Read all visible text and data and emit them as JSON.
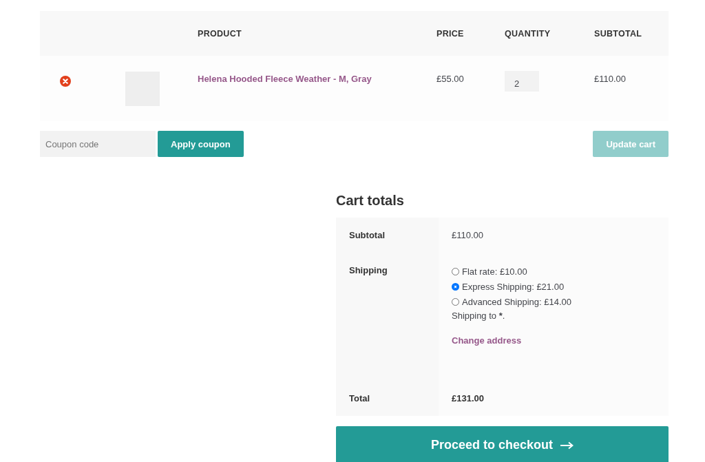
{
  "cart_table": {
    "columns": [
      "PRODUCT",
      "PRICE",
      "QUANTITY",
      "SUBTOTAL"
    ],
    "rows": [
      {
        "product": "Helena Hooded Fleece Weather - M, Gray",
        "price": "£55.00",
        "quantity": "2",
        "subtotal": "£110.00"
      }
    ]
  },
  "coupon": {
    "placeholder": "Coupon code",
    "apply_button": "Apply coupon"
  },
  "update_cart": {
    "label": "Update cart",
    "disabled": true
  },
  "cart_totals": {
    "title": "Cart totals",
    "subtotal_label": "Subtotal",
    "subtotal": "£110.00",
    "shipping_label": "Shipping",
    "shipping_options": [
      {
        "label": "Flat rate: £10.00",
        "selected": false
      },
      {
        "label": "Express Shipping: £21.00",
        "selected": true
      },
      {
        "label": "Advanced Shipping: £14.00",
        "selected": false
      }
    ],
    "shipping_to": {
      "prefix": "Shipping to ",
      "place": "*",
      "suffix": "."
    },
    "change_address": "Change address",
    "total_label": "Total",
    "total": "£131.00"
  },
  "checkout_button": "Proceed to checkout"
}
